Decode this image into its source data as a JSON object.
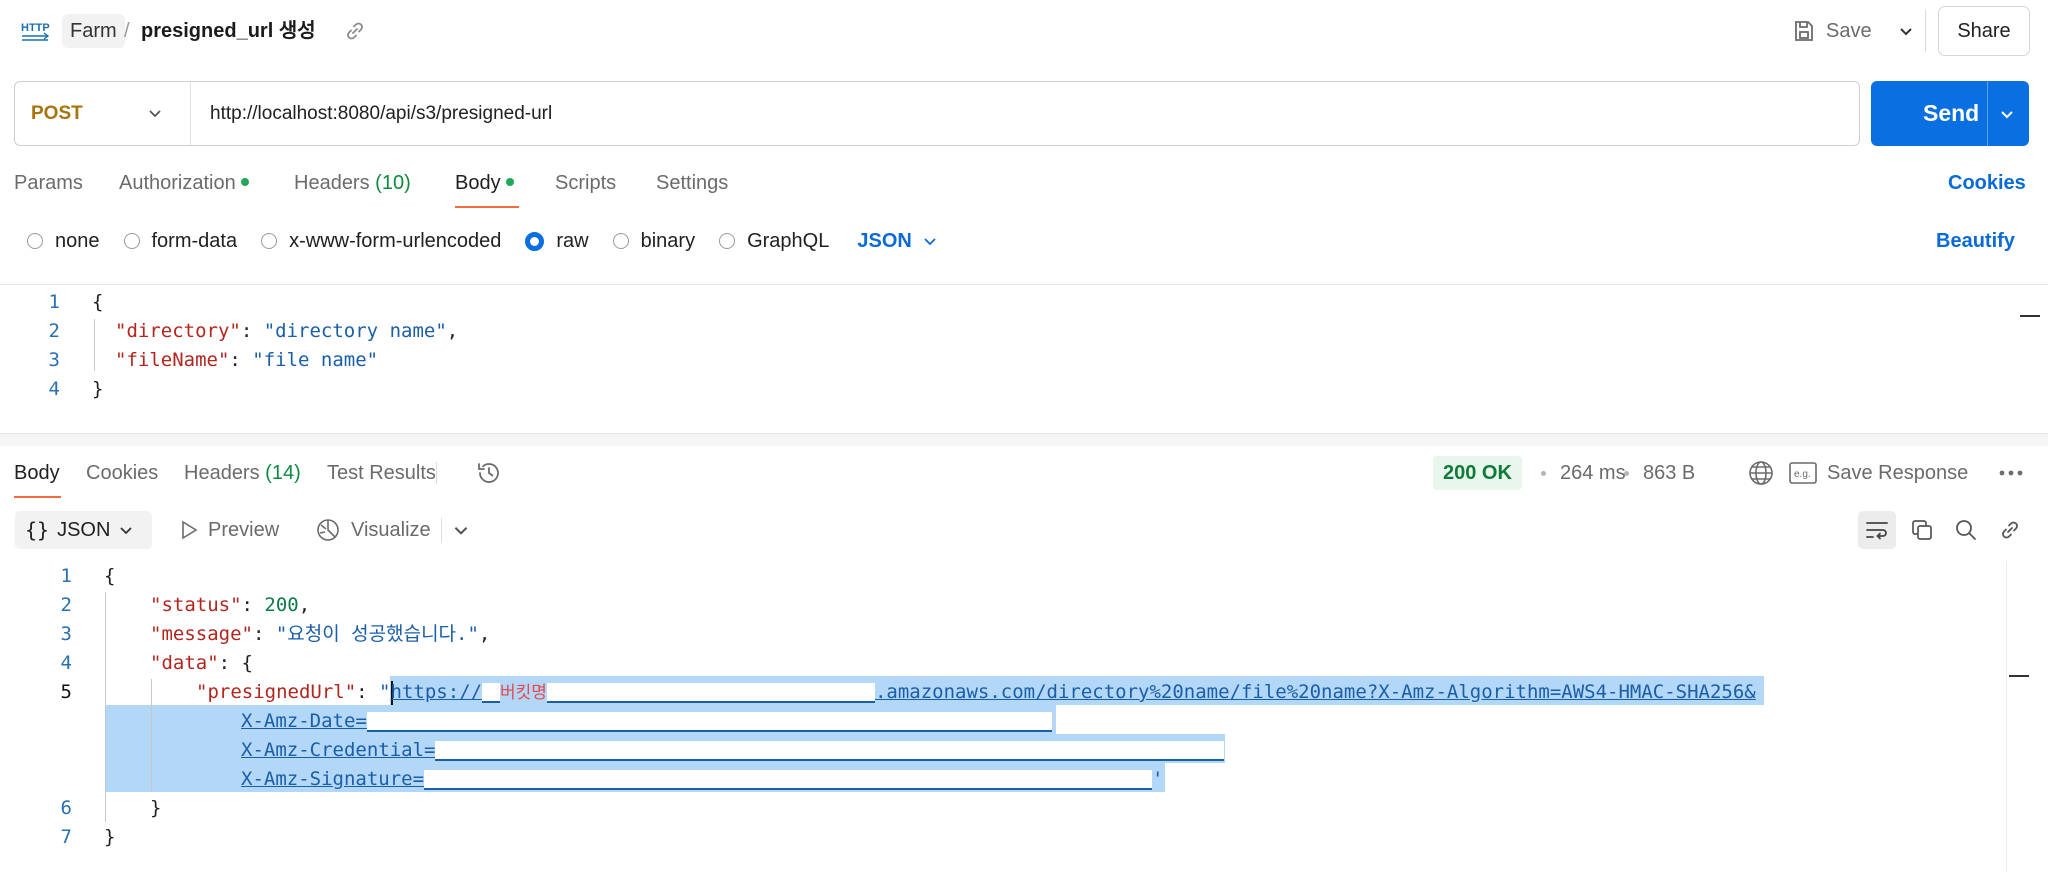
{
  "topbar": {
    "app_icon": "http-icon",
    "collection": "Farm",
    "separator": "/",
    "request_name": "presigned_url 생성",
    "save_label": "Save",
    "share_label": "Share"
  },
  "request": {
    "method": "POST",
    "url": "http://localhost:8080/api/s3/presigned-url",
    "send_label": "Send"
  },
  "request_tabs": [
    {
      "label": "Params"
    },
    {
      "label": "Authorization",
      "dot": true
    },
    {
      "label": "Headers",
      "count": "(10)"
    },
    {
      "label": "Body",
      "dot": true,
      "active": true
    },
    {
      "label": "Scripts"
    },
    {
      "label": "Settings"
    }
  ],
  "cookies_label": "Cookies",
  "body_types": [
    "none",
    "form-data",
    "x-www-form-urlencoded",
    "raw",
    "binary",
    "GraphQL"
  ],
  "body_type_selected": "raw",
  "body_format": "JSON",
  "beautify_label": "Beautify",
  "request_body": {
    "line_numbers": [
      "1",
      "2",
      "3",
      "4"
    ],
    "open_brace": "{",
    "key1": "\"directory\"",
    "val1": "\"directory name\"",
    "key2": "\"fileName\"",
    "val2": "\"file name\"",
    "close_brace": "}"
  },
  "response_tabs": [
    {
      "label": "Body",
      "active": true
    },
    {
      "label": "Cookies"
    },
    {
      "label": "Headers",
      "count": "(14)"
    },
    {
      "label": "Test Results"
    }
  ],
  "response_meta": {
    "status": "200 OK",
    "time": "264 ms",
    "size": "863 B",
    "save_response": "Save Response"
  },
  "response_toolbar": {
    "format": "JSON",
    "preview": "Preview",
    "visualize": "Visualize"
  },
  "response_body": {
    "line_numbers": [
      "1",
      "2",
      "3",
      "4",
      "5",
      "6",
      "7"
    ],
    "open_brace": "{",
    "status_key": "\"status\"",
    "status_val": "200",
    "message_key": "\"message\"",
    "message_val": "\"요청이 성공했습니다.\"",
    "data_key": "\"data\"",
    "presigned_key": "\"presignedUrl\"",
    "url_scheme": "https://",
    "bucket_label": "버킷명",
    "url_rest": ".amazonaws.com/directory%20name/file%20name?X-Amz-Algorithm=AWS4-HMAC-SHA256&",
    "amz_date": "X-Amz-Date=",
    "amz_credential": "X-Amz-Credential=",
    "amz_signature": "X-Amz-Signature=",
    "inner_close": "}",
    "close_brace": "}"
  }
}
